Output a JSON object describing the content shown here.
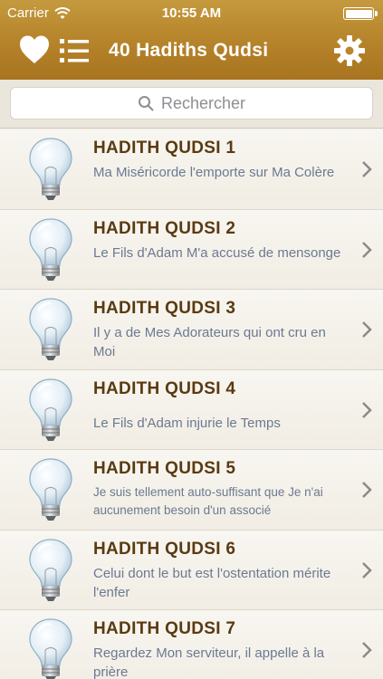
{
  "status": {
    "carrier": "Carrier",
    "time": "10:55 AM",
    "battery_level": 1.0
  },
  "nav": {
    "title": "40 Hadiths Qudsi"
  },
  "search": {
    "placeholder": "Rechercher"
  },
  "hadiths": [
    {
      "title": "HADITH QUDSI 1",
      "subtitle": "Ma Miséricorde l'emporte sur Ma Colère"
    },
    {
      "title": "HADITH QUDSI 2",
      "subtitle": "Le Fils d'Adam M'a accusé de mensonge"
    },
    {
      "title": "HADITH QUDSI 3",
      "subtitle": "Il y a de Mes Adorateurs qui ont cru en Moi"
    },
    {
      "title": "HADITH QUDSI 4",
      "subtitle": "Le Fils d'Adam injurie le Temps"
    },
    {
      "title": "HADITH QUDSI 5",
      "subtitle": "Je suis tellement auto-suffisant que Je n'ai aucunement besoin d'un associé"
    },
    {
      "title": "HADITH QUDSI 6",
      "subtitle": "Celui dont le but est l'ostentation mérite l'enfer"
    },
    {
      "title": "HADITH QUDSI 7",
      "subtitle": "Regardez Mon serviteur, il appelle à la prière"
    }
  ],
  "colors": {
    "header": "#b8862c",
    "title_text": "#5a3a10",
    "subtitle_text": "#6b7a8f"
  },
  "icons": [
    "heart-icon",
    "list-icon",
    "gear-icon",
    "search-icon",
    "lightbulb-icon",
    "chevron-right-icon"
  ]
}
